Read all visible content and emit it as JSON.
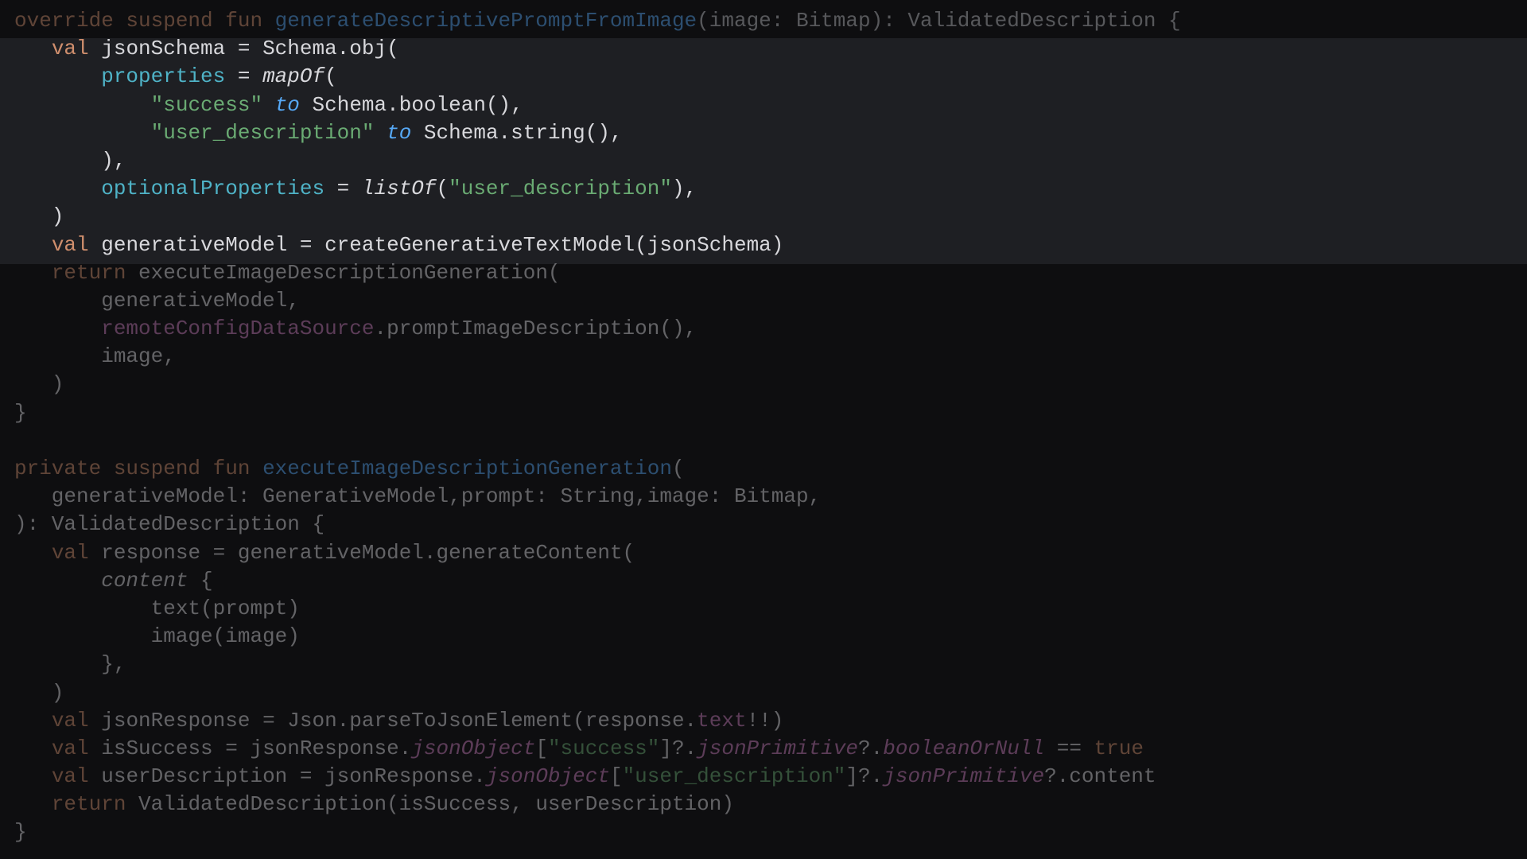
{
  "editor": {
    "language": "Kotlin",
    "theme_colors": {
      "background": "#0e0e10",
      "highlight_band": "#1e1f23",
      "keyword": "#cf8e6d",
      "function": "#56a8f5",
      "property": "#4fb3c7",
      "string": "#6aab73",
      "text": "#d8d8dc"
    },
    "lines": [
      {
        "dim": true,
        "tokens": [
          {
            "c": "kw",
            "t": "override suspend fun "
          },
          {
            "c": "fn",
            "t": "generateDescriptivePromptFromImage"
          },
          {
            "c": "muted",
            "t": "(image: Bitmap): ValidatedDescription {"
          }
        ]
      },
      {
        "dim": false,
        "tokens": [
          {
            "c": "plain",
            "t": "   "
          },
          {
            "c": "kw",
            "t": "val "
          },
          {
            "c": "plain",
            "t": "jsonSchema = Schema.obj("
          }
        ]
      },
      {
        "dim": false,
        "tokens": [
          {
            "c": "plain",
            "t": "       "
          },
          {
            "c": "prop",
            "t": "properties"
          },
          {
            "c": "plain",
            "t": " = "
          },
          {
            "c": "plain ital",
            "t": "mapOf"
          },
          {
            "c": "plain",
            "t": "("
          }
        ]
      },
      {
        "dim": false,
        "tokens": [
          {
            "c": "plain",
            "t": "           "
          },
          {
            "c": "str",
            "t": "\"success\""
          },
          {
            "c": "plain",
            "t": " "
          },
          {
            "c": "ext",
            "t": "to"
          },
          {
            "c": "plain",
            "t": " Schema.boolean(),"
          }
        ]
      },
      {
        "dim": false,
        "tokens": [
          {
            "c": "plain",
            "t": "           "
          },
          {
            "c": "str",
            "t": "\"user_description\""
          },
          {
            "c": "plain",
            "t": " "
          },
          {
            "c": "ext",
            "t": "to"
          },
          {
            "c": "plain",
            "t": " Schema.string(),"
          }
        ]
      },
      {
        "dim": false,
        "tokens": [
          {
            "c": "plain",
            "t": "       ),"
          }
        ]
      },
      {
        "dim": false,
        "tokens": [
          {
            "c": "plain",
            "t": "       "
          },
          {
            "c": "prop",
            "t": "optionalProperties"
          },
          {
            "c": "plain",
            "t": " = "
          },
          {
            "c": "plain ital",
            "t": "listOf"
          },
          {
            "c": "plain",
            "t": "("
          },
          {
            "c": "str",
            "t": "\"user_description\""
          },
          {
            "c": "plain",
            "t": "),"
          }
        ]
      },
      {
        "dim": false,
        "tokens": [
          {
            "c": "plain",
            "t": "   )"
          }
        ]
      },
      {
        "dim": false,
        "tokens": [
          {
            "c": "plain",
            "t": "   "
          },
          {
            "c": "kw",
            "t": "val "
          },
          {
            "c": "plain",
            "t": "generativeModel = createGenerativeTextModel(jsonSchema)"
          }
        ]
      },
      {
        "dim": true,
        "tokens": [
          {
            "c": "plain",
            "t": "   "
          },
          {
            "c": "kw",
            "t": "return "
          },
          {
            "c": "plain",
            "t": "executeImageDescriptionGeneration("
          }
        ]
      },
      {
        "dim": true,
        "tokens": [
          {
            "c": "plain",
            "t": "       generativeModel,"
          }
        ]
      },
      {
        "dim": true,
        "tokens": [
          {
            "c": "plain",
            "t": "       "
          },
          {
            "c": "field",
            "t": "remoteConfigDataSource"
          },
          {
            "c": "plain",
            "t": ".promptImageDescription(),"
          }
        ]
      },
      {
        "dim": true,
        "tokens": [
          {
            "c": "plain",
            "t": "       image,"
          }
        ]
      },
      {
        "dim": true,
        "tokens": [
          {
            "c": "plain",
            "t": "   )"
          }
        ]
      },
      {
        "dim": true,
        "tokens": [
          {
            "c": "plain",
            "t": "}"
          }
        ]
      },
      {
        "dim": true,
        "tokens": [
          {
            "c": "plain",
            "t": " "
          }
        ]
      },
      {
        "dim": true,
        "tokens": [
          {
            "c": "kw",
            "t": "private suspend fun "
          },
          {
            "c": "fn",
            "t": "executeImageDescriptionGeneration"
          },
          {
            "c": "plain",
            "t": "("
          }
        ]
      },
      {
        "dim": true,
        "tokens": [
          {
            "c": "plain",
            "t": "   generativeModel: GenerativeModel,prompt: String,image: Bitmap,"
          }
        ]
      },
      {
        "dim": true,
        "tokens": [
          {
            "c": "plain",
            "t": "): ValidatedDescription {"
          }
        ]
      },
      {
        "dim": true,
        "tokens": [
          {
            "c": "plain",
            "t": "   "
          },
          {
            "c": "kw",
            "t": "val "
          },
          {
            "c": "plain",
            "t": "response = generativeModel.generateContent("
          }
        ]
      },
      {
        "dim": true,
        "tokens": [
          {
            "c": "plain",
            "t": "       "
          },
          {
            "c": "plain ital",
            "t": "content"
          },
          {
            "c": "plain",
            "t": " {"
          }
        ]
      },
      {
        "dim": true,
        "tokens": [
          {
            "c": "plain",
            "t": "           text(prompt)"
          }
        ]
      },
      {
        "dim": true,
        "tokens": [
          {
            "c": "plain",
            "t": "           image(image)"
          }
        ]
      },
      {
        "dim": true,
        "tokens": [
          {
            "c": "plain",
            "t": "       },"
          }
        ]
      },
      {
        "dim": true,
        "tokens": [
          {
            "c": "plain",
            "t": "   )"
          }
        ]
      },
      {
        "dim": true,
        "tokens": [
          {
            "c": "plain",
            "t": "   "
          },
          {
            "c": "kw",
            "t": "val "
          },
          {
            "c": "plain",
            "t": "jsonResponse = Json.parseToJsonElement(response."
          },
          {
            "c": "field",
            "t": "text"
          },
          {
            "c": "plain",
            "t": "!!)"
          }
        ]
      },
      {
        "dim": true,
        "tokens": [
          {
            "c": "plain",
            "t": "   "
          },
          {
            "c": "kw",
            "t": "val "
          },
          {
            "c": "plain",
            "t": "isSuccess = jsonResponse."
          },
          {
            "c": "ext2",
            "t": "jsonObject"
          },
          {
            "c": "plain",
            "t": "["
          },
          {
            "c": "str",
            "t": "\"success\""
          },
          {
            "c": "plain",
            "t": "]?."
          },
          {
            "c": "ext2",
            "t": "jsonPrimitive"
          },
          {
            "c": "plain",
            "t": "?."
          },
          {
            "c": "ext2",
            "t": "booleanOrNull"
          },
          {
            "c": "plain",
            "t": " == "
          },
          {
            "c": "kw",
            "t": "true"
          }
        ]
      },
      {
        "dim": true,
        "tokens": [
          {
            "c": "plain",
            "t": "   "
          },
          {
            "c": "kw",
            "t": "val "
          },
          {
            "c": "plain",
            "t": "userDescription = jsonResponse."
          },
          {
            "c": "ext2",
            "t": "jsonObject"
          },
          {
            "c": "plain",
            "t": "["
          },
          {
            "c": "str",
            "t": "\"user_description\""
          },
          {
            "c": "plain",
            "t": "]?."
          },
          {
            "c": "ext2",
            "t": "jsonPrimitive"
          },
          {
            "c": "plain",
            "t": "?.content"
          }
        ]
      },
      {
        "dim": true,
        "tokens": [
          {
            "c": "plain",
            "t": "   "
          },
          {
            "c": "kw",
            "t": "return "
          },
          {
            "c": "plain",
            "t": "ValidatedDescription(isSuccess, userDescription)"
          }
        ]
      },
      {
        "dim": true,
        "tokens": [
          {
            "c": "plain",
            "t": "}"
          }
        ]
      }
    ]
  }
}
